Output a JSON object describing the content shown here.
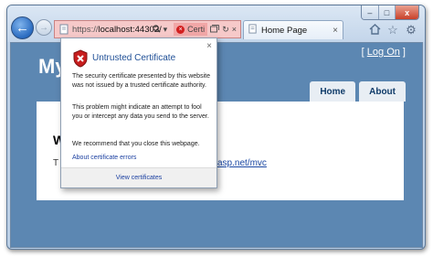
{
  "browser": {
    "address_prefix": "https://",
    "address_host": "localhost:44302/",
    "cert_error_label": "Certi",
    "tab_title": "Home Page",
    "tab_close": "×",
    "back_glyph": "←",
    "forward_glyph": "→",
    "window_controls": [
      "‒",
      "□",
      "x"
    ]
  },
  "site": {
    "title": "My",
    "logon_prefix": "[ ",
    "logon_label": "Log On",
    "logon_suffix": " ]",
    "nav": [
      "Home",
      "About"
    ],
    "heading": "W",
    "text": "T",
    "link_text": "asp.net/mvc",
    "link_suffix": "."
  },
  "popup": {
    "title": "Untrusted Certificate",
    "close_label": "×",
    "paragraph1": "The security certificate presented by this website was not issued by a trusted certificate authority.",
    "paragraph2": "This problem might indicate an attempt to fool you or intercept any data you send to the server.",
    "paragraph3": "We recommend that you close this webpage.",
    "about_link": "About certificate errors",
    "view_button": "View certificates"
  },
  "colors": {
    "page_background": "#5c87b2",
    "address_error": "#f6c9c9",
    "popup_title": "#1f4f96",
    "link": "#1a3fa0"
  }
}
